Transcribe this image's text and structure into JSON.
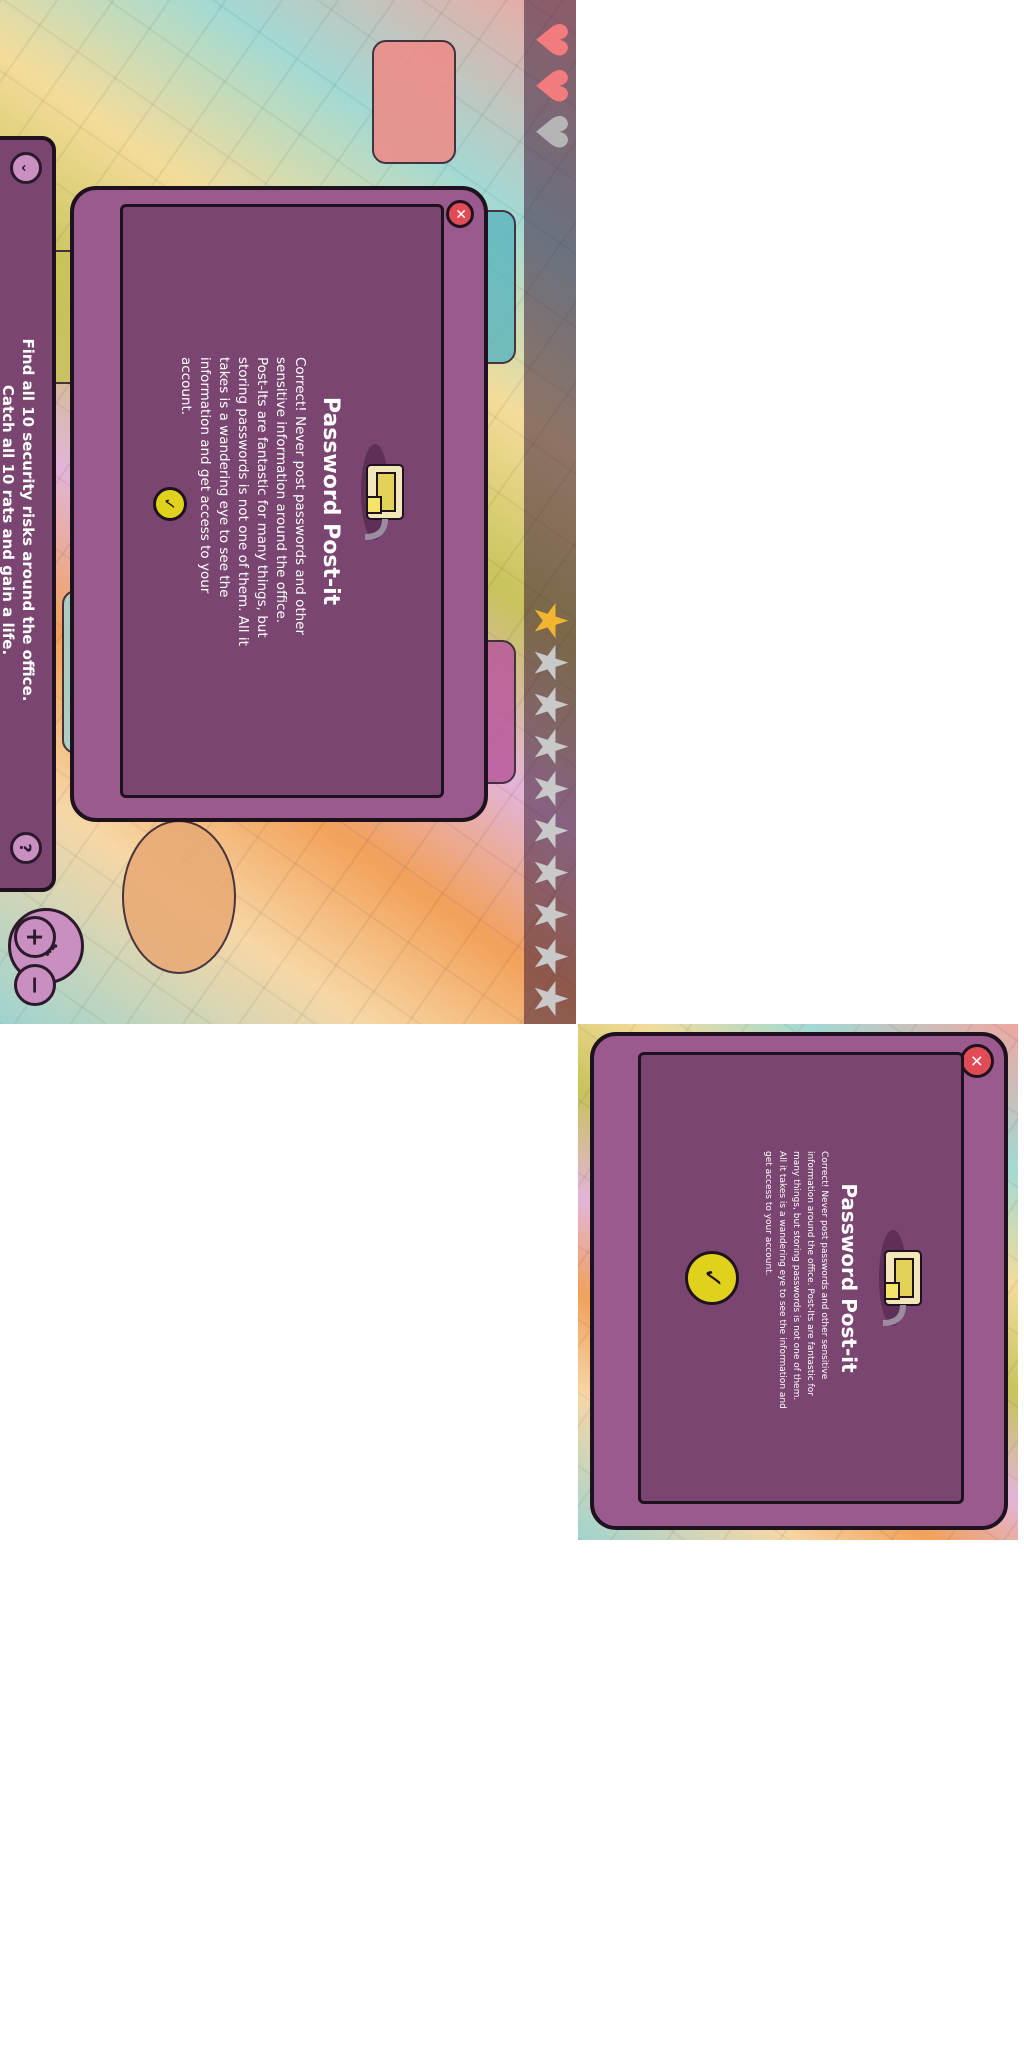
{
  "dialog": {
    "title": "Password Post-it",
    "body": "Correct! Never post passwords and other sensitive information around the office. Post-Its are fantastic for many things, but storing passwords is not one of them. All it takes is a wandering eye to see the information and get access to your account.",
    "close_icon": "close-x-icon",
    "confirm_icon": "checkmark-icon",
    "illustration_icon": "printer-with-post-it-icon"
  },
  "sidebar": {
    "help_label": "?",
    "collapse_icon": "chevron-icon",
    "objective_line1": "Find all 10 security risks around the office.",
    "objective_line2": "Catch all 10 rats and gain a life."
  },
  "zoom": {
    "in_label": "+",
    "out_label": "−"
  },
  "lives": {
    "remaining": 2,
    "total": 3,
    "icon": "heart-icon"
  },
  "risks": {
    "found": 1,
    "total": 10,
    "icon": "star-icon"
  },
  "colors": {
    "panel_purple": "#7a4570",
    "frame_purple": "#9b5a8d",
    "close_red": "#e04b55",
    "confirm_yellow": "#e0d21c",
    "heart_red": "#f27b7e",
    "star_gold": "#f2b530"
  }
}
